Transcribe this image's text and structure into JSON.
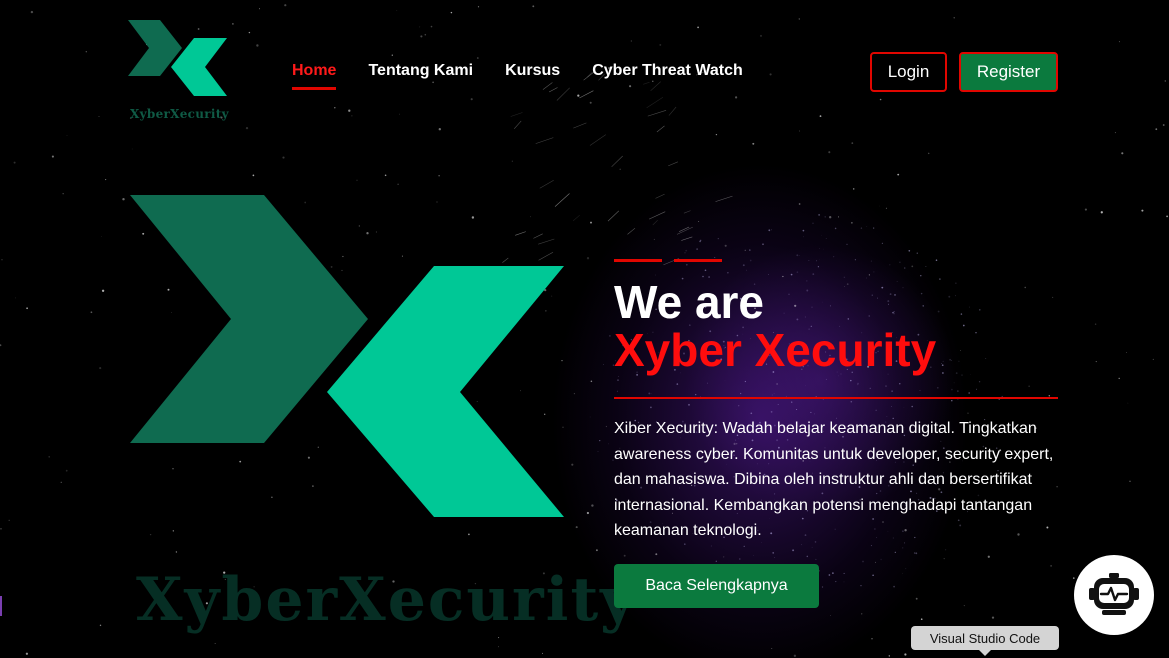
{
  "brand": {
    "logo_icon": "xx-logo-icon",
    "name": "XyberXecurity",
    "colors": {
      "green_dark": "#0f6b50",
      "green_light": "#00c896",
      "accent_red": "#e10600",
      "button_green": "#0b7a3e"
    }
  },
  "nav": {
    "items": [
      {
        "label": "Home",
        "active": true
      },
      {
        "label": "Tentang Kami",
        "active": false
      },
      {
        "label": "Kursus",
        "active": false
      },
      {
        "label": "Cyber Threat Watch",
        "active": false
      }
    ]
  },
  "auth": {
    "login_label": "Login",
    "register_label": "Register"
  },
  "hero": {
    "line1": "We are",
    "line2": "Xyber Xecurity",
    "description": "Xiber Xecurity: Wadah belajar keamanan digital. Tingkatkan awareness cyber. Komunitas untuk developer, security expert, dan mahasiswa. Dibina oleh instruktur ahli dan bersertifikat internasional. Kembangkan potensi menghadapi tantangan keamanan teknologi.",
    "cta_label": "Baca Selengkapnya",
    "wordmark": "XyberXecurity"
  },
  "chatbot": {
    "icon": "robot-icon"
  },
  "tooltip": {
    "text": "Visual Studio Code"
  }
}
